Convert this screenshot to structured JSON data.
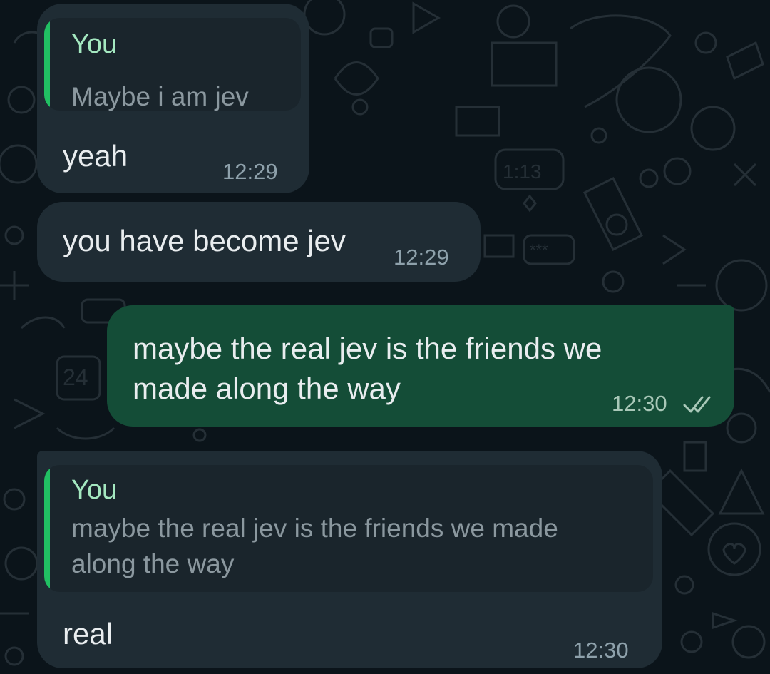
{
  "messages": [
    {
      "direction": "incoming",
      "quote": {
        "author": "You",
        "text": "Maybe i am jev"
      },
      "text": "yeah",
      "time": "12:29"
    },
    {
      "direction": "incoming",
      "text": "you have become jev",
      "time": "12:29"
    },
    {
      "direction": "outgoing",
      "text_lines": [
        "maybe the real jev is the friends we",
        "made along the way"
      ],
      "time": "12:30",
      "status_icon": "double-check-icon"
    },
    {
      "direction": "incoming",
      "quote": {
        "author": "You",
        "text_lines": [
          "maybe the real jev is the friends we made",
          "along the way"
        ]
      },
      "text": "real",
      "time": "12:30"
    }
  ],
  "wallpaper": {
    "doodle_text": [
      "1:13",
      "***",
      "24"
    ]
  },
  "colors": {
    "background": "#0b141a",
    "incoming_bubble": "#1f2c34",
    "outgoing_bubble": "#144d37",
    "quote_bar": "#21c063",
    "quote_author": "#a4e8c0"
  }
}
